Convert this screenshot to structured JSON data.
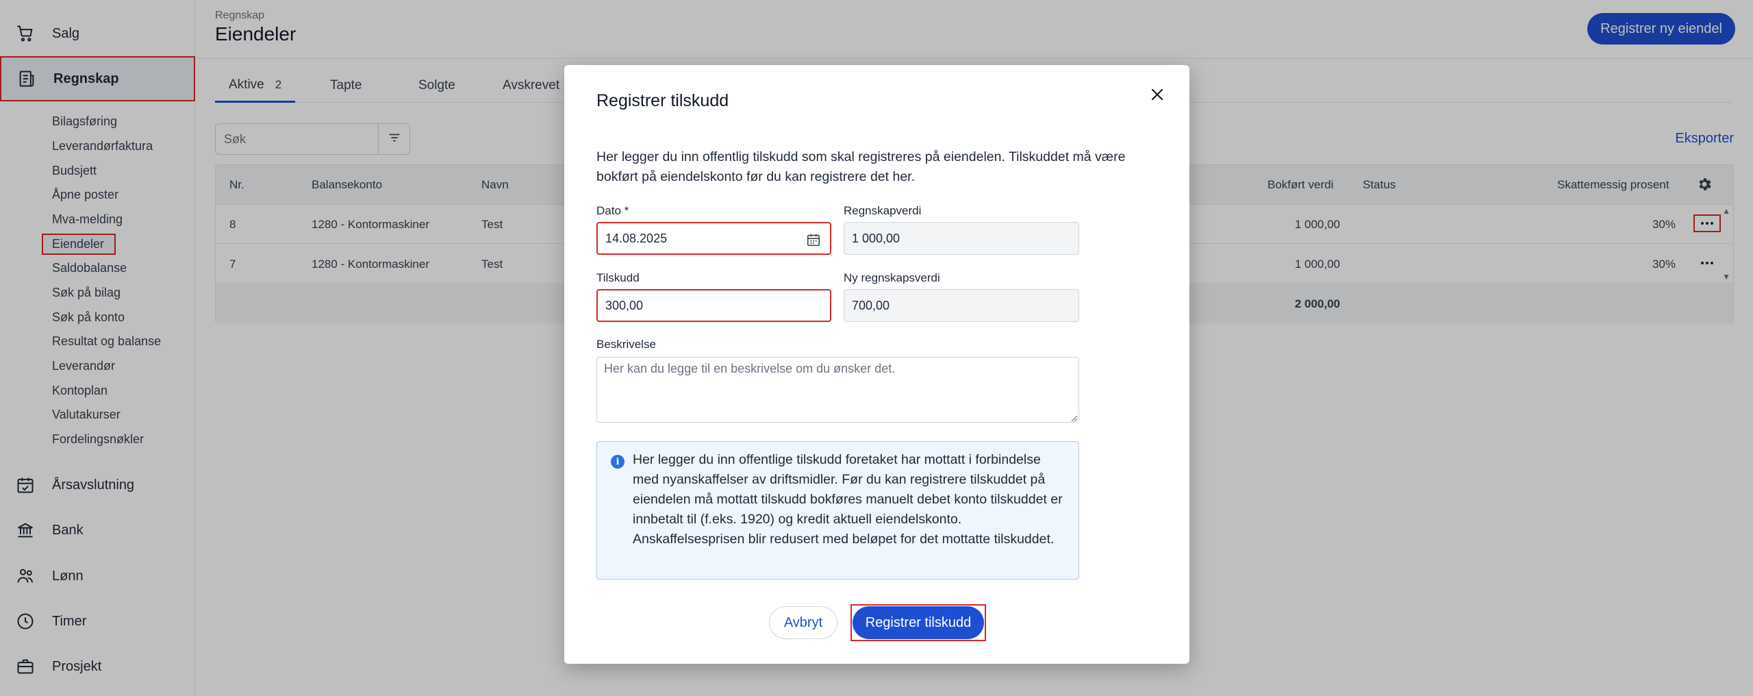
{
  "sidebar": {
    "main_items": [
      {
        "label": "Salg",
        "icon": "cart-icon"
      },
      {
        "label": "Regnskap",
        "icon": "ledger-icon"
      },
      {
        "label": "Årsavslutning",
        "icon": "calendar-check-icon"
      },
      {
        "label": "Bank",
        "icon": "bank-icon"
      },
      {
        "label": "Lønn",
        "icon": "people-icon"
      },
      {
        "label": "Timer",
        "icon": "clock-icon"
      },
      {
        "label": "Prosjekt",
        "icon": "briefcase-icon"
      }
    ],
    "sub_items": [
      "Bilagsføring",
      "Leverandørfaktura",
      "Budsjett",
      "Åpne poster",
      "Mva-melding",
      "Eiendeler",
      "Saldobalanse",
      "Søk på bilag",
      "Søk på konto",
      "Resultat og balanse",
      "Leverandør",
      "Kontoplan",
      "Valutakurser",
      "Fordelingsnøkler"
    ]
  },
  "header": {
    "breadcrumb": "Regnskap",
    "title": "Eiendeler",
    "new_asset_button": "Registrer ny eiendel"
  },
  "tabs": [
    {
      "label": "Aktive",
      "count": "2"
    },
    {
      "label": "Tapte"
    },
    {
      "label": "Solgte"
    },
    {
      "label": "Avskrevet"
    }
  ],
  "search": {
    "placeholder": "Søk"
  },
  "export_label": "Eksporter",
  "table": {
    "columns": [
      "Nr.",
      "Balansekonto",
      "Navn",
      "Bokført verdi",
      "Status",
      "Skattemessig prosent"
    ],
    "rows": [
      {
        "nr": "8",
        "account": "1280 - Kontormaskiner",
        "name": "Test",
        "book_value": "1 000,00",
        "status": "",
        "tax_percent": "30%"
      },
      {
        "nr": "7",
        "account": "1280 - Kontormaskiner",
        "name": "Test",
        "book_value": "1 000,00",
        "status": "",
        "tax_percent": "30%"
      }
    ],
    "total": "2 000,00"
  },
  "modal": {
    "title": "Registrer tilskudd",
    "intro": "Her legger du inn offentlig tilskudd som skal registreres på eiendelen. Tilskuddet må være bokført på eiendelskonto før du kan registrere det her.",
    "date_label": "Dato *",
    "date_value": "14.08.2025",
    "book_value_label": "Regnskapverdi",
    "book_value": "1 000,00",
    "grant_label": "Tilskudd",
    "grant_value": "300,00",
    "new_book_value_label": "Ny regnskapsverdi",
    "new_book_value": "700,00",
    "description_label": "Beskrivelse",
    "description_placeholder": "Her kan du legge til en beskrivelse om du ønsker det.",
    "info_text": "Her legger du inn offentlige tilskudd foretaket har mottatt i forbindelse med nyanskaffelser av driftsmidler. Før du kan registrere tilskuddet på eiendelen må mottatt tilskudd bokføres manuelt debet konto tilskuddet er innbetalt til (f.eks. 1920) og kredit aktuell eiendelskonto. Anskaffelsesprisen blir redusert med beløpet for det mottatte tilskuddet.",
    "cancel_label": "Avbryt",
    "submit_label": "Registrer tilskudd"
  },
  "colors": {
    "primary": "#1f4fd1",
    "highlight": "#d62828",
    "overlay": "rgba(0,0,0,0.25)"
  }
}
